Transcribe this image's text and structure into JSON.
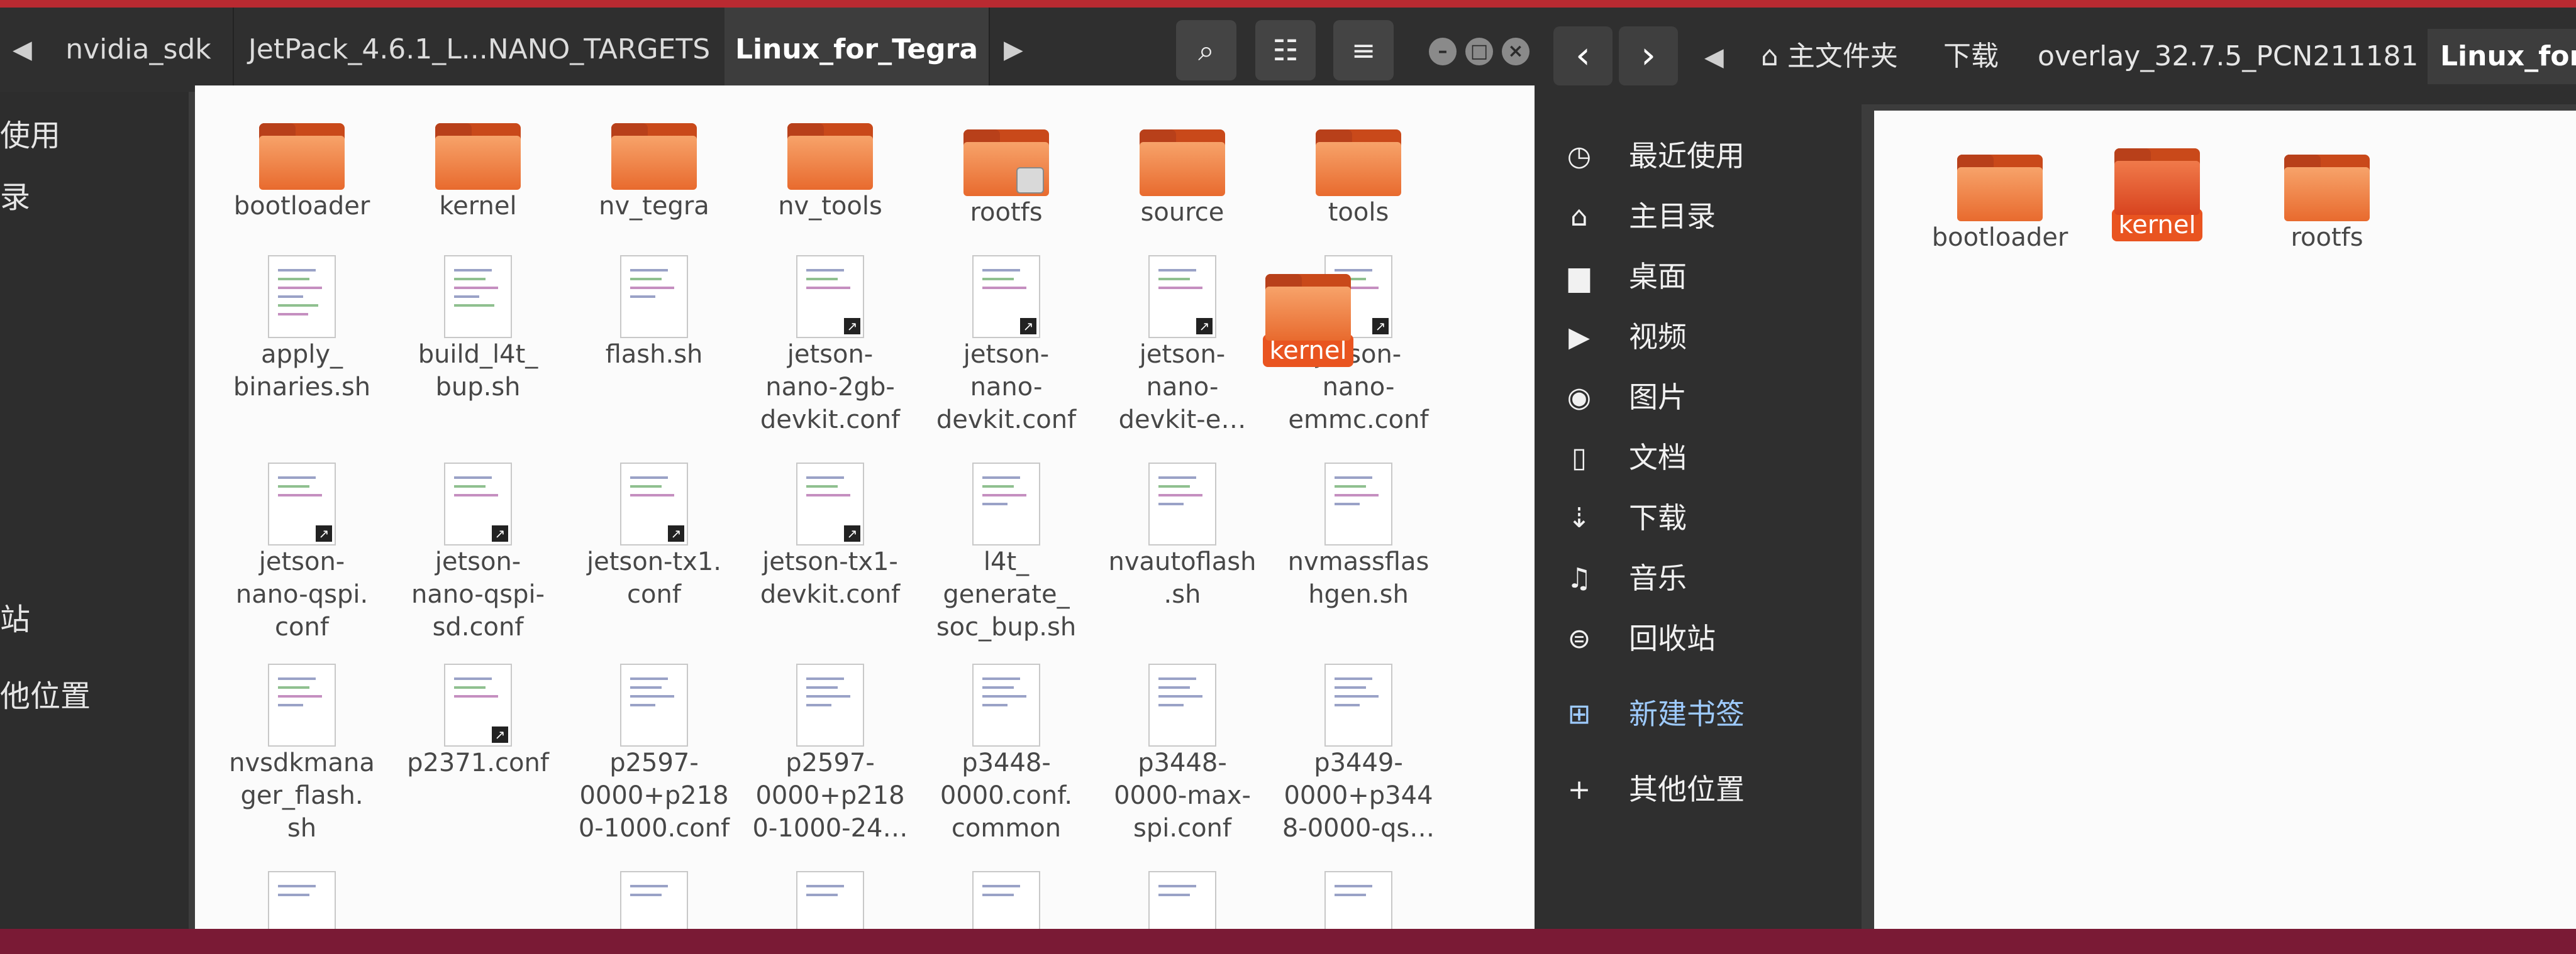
{
  "left_window": {
    "tabs": [
      {
        "label": "nvidia_sdk"
      },
      {
        "label": "JetPack_4.6.1_L...NANO_TARGETS"
      },
      {
        "label": "Linux_for_Tegra"
      }
    ],
    "sidebar_fragments": [
      "使用",
      "录",
      "站",
      "他位置"
    ],
    "items": [
      {
        "label": "bootloader",
        "type": "folder"
      },
      {
        "label": "kernel",
        "type": "folder"
      },
      {
        "label": "nv_tegra",
        "type": "folder"
      },
      {
        "label": "nv_tools",
        "type": "folder"
      },
      {
        "label": "rootfs",
        "type": "folder-locked"
      },
      {
        "label": "source",
        "type": "folder"
      },
      {
        "label": "tools",
        "type": "folder"
      },
      {
        "label": "apply_\nbinaries.sh",
        "type": "script"
      },
      {
        "label": "build_l4t_\nbup.sh",
        "type": "script"
      },
      {
        "label": "flash.sh",
        "type": "script"
      },
      {
        "label": "jetson-\nnano-2gb-\ndevkit.conf",
        "type": "link"
      },
      {
        "label": "jetson-\nnano-\ndevkit.conf",
        "type": "link"
      },
      {
        "label": "jetson-\nnano-\ndevkit-e…",
        "type": "link"
      },
      {
        "label": "jetson-\nnano-\nemmc.conf",
        "type": "link"
      },
      {
        "label": "jetson-\nnano-qspi.\nconf",
        "type": "link"
      },
      {
        "label": "jetson-\nnano-qspi-\nsd.conf",
        "type": "link"
      },
      {
        "label": "jetson-tx1.\nconf",
        "type": "link"
      },
      {
        "label": "jetson-tx1-\ndevkit.conf",
        "type": "link"
      },
      {
        "label": "l4t_\ngenerate_\nsoc_bup.sh",
        "type": "script"
      },
      {
        "label": "nvautoflash\n.sh",
        "type": "script"
      },
      {
        "label": "nvmassflas\nhgen.sh",
        "type": "script"
      },
      {
        "label": "nvsdkmana\nger_flash.\nsh",
        "type": "script"
      },
      {
        "label": "p2371.conf",
        "type": "link"
      },
      {
        "label": "p2597-\n0000+p218\n0-1000.conf",
        "type": "text"
      },
      {
        "label": "p2597-\n0000+p218\n0-1000-24…",
        "type": "text"
      },
      {
        "label": "p3448-\n0000.conf.\ncommon",
        "type": "text"
      },
      {
        "label": "p3448-\n0000-max-\nspi.conf",
        "type": "text"
      },
      {
        "label": "p3449-\n0000+p344\n8-0000-qs…",
        "type": "text"
      }
    ],
    "drag_label": "kernel"
  },
  "right_window": {
    "breadcrumbs": [
      {
        "label": "主文件夹"
      },
      {
        "label": "下载"
      },
      {
        "label": "overlay_32.7.5_PCN211181"
      },
      {
        "label": "Linux_for_"
      }
    ],
    "sidebar": [
      {
        "label": "最近使用",
        "icon": "clock-icon"
      },
      {
        "label": "主目录",
        "icon": "home-icon"
      },
      {
        "label": "桌面",
        "icon": "desktop-icon"
      },
      {
        "label": "视频",
        "icon": "video-icon"
      },
      {
        "label": "图片",
        "icon": "camera-icon"
      },
      {
        "label": "文档",
        "icon": "document-icon"
      },
      {
        "label": "下载",
        "icon": "download-icon"
      },
      {
        "label": "音乐",
        "icon": "music-icon"
      },
      {
        "label": "回收站",
        "icon": "trash-icon"
      },
      {
        "label": "新建书签",
        "icon": "bookmark-add-icon"
      },
      {
        "label": "其他位置",
        "icon": "plus-icon"
      }
    ],
    "items": [
      {
        "label": "bootloader",
        "selected": false
      },
      {
        "label": "kernel",
        "selected": true
      },
      {
        "label": "rootfs",
        "selected": false
      }
    ]
  },
  "colors": {
    "accent": "#e95420",
    "bookmark": "#9ecbff"
  }
}
